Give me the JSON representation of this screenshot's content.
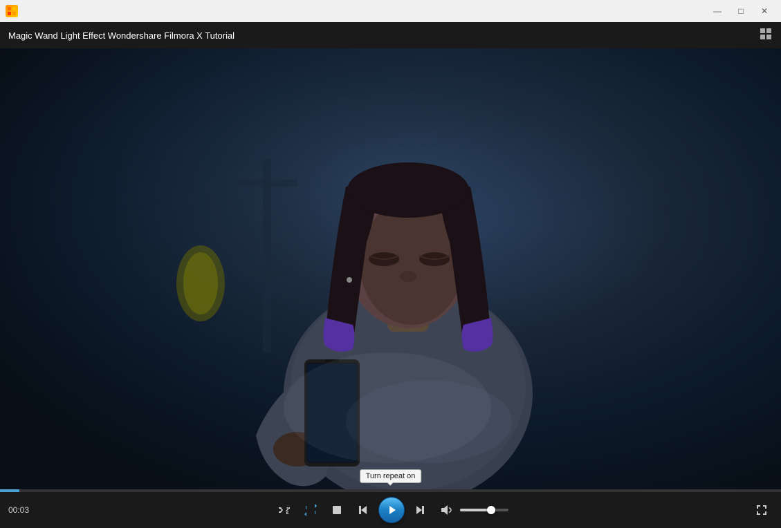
{
  "titlebar": {
    "app_icon": "▶",
    "title": "",
    "min_label": "—",
    "max_label": "□",
    "close_label": "✕"
  },
  "media_title": {
    "text": "Magic Wand Light Effect  Wondershare Filmora X Tutorial",
    "grid_icon": "⊞"
  },
  "controls": {
    "time": "00:03",
    "shuffle_icon": "shuffle",
    "repeat_icon": "repeat",
    "stop_icon": "stop",
    "prev_icon": "prev",
    "play_icon": "▶",
    "next_icon": "next",
    "volume_icon": "volume",
    "fullscreen_icon": "fullscreen",
    "tooltip_text": "Turn repeat on"
  },
  "progress": {
    "fill_percent": 2.5
  },
  "volume": {
    "level_percent": 65
  }
}
